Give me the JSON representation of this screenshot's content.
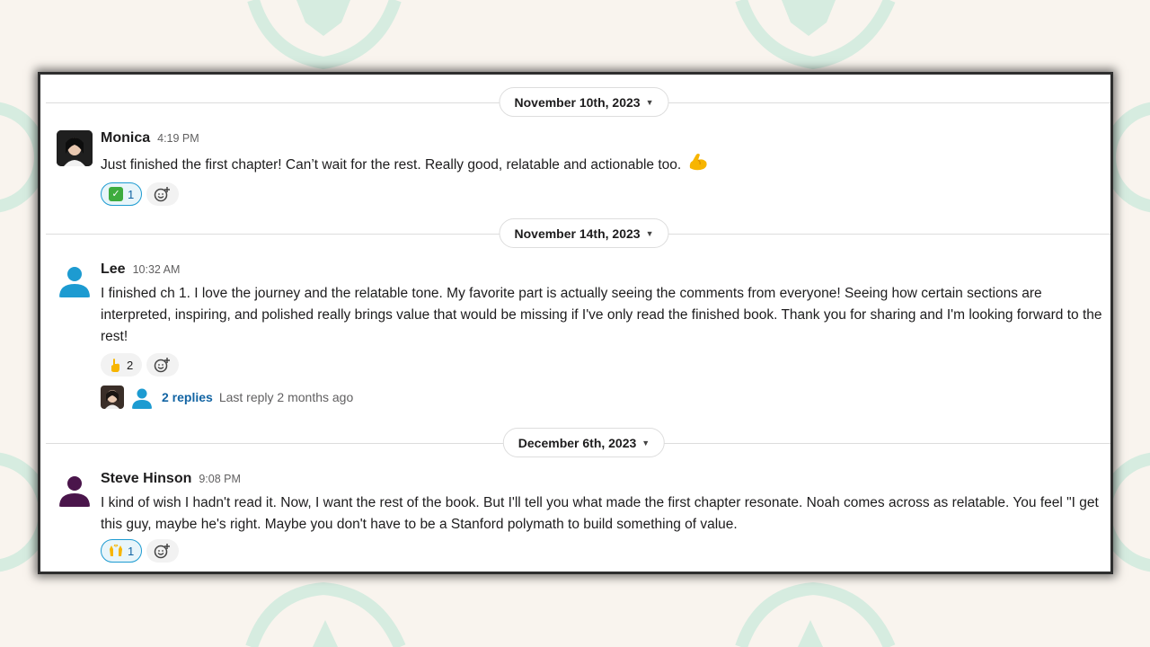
{
  "date_dividers": [
    "November 10th, 2023",
    "November 14th, 2023",
    "December 6th, 2023"
  ],
  "messages": [
    {
      "author": "Monica",
      "time": "4:19 PM",
      "text": "Just finished the first chapter! Can’t wait for the rest. Really good, relatable and actionable too.",
      "trailing_emoji": "flexed-biceps",
      "reaction": {
        "emoji": "white-check-mark",
        "count": "1",
        "active": true
      }
    },
    {
      "author": "Lee",
      "time": "10:32 AM",
      "text": "I finished ch 1. I love the journey and the relatable tone.  My favorite part is actually seeing the comments from everyone! Seeing how certain sections are interpreted, inspiring, and polished really brings value that would be missing if I've only read the finished book.  Thank you for sharing and I'm looking forward to the rest!",
      "reaction": {
        "emoji": "pointing-hand",
        "count": "2",
        "active": false
      },
      "thread": {
        "replies": "2 replies",
        "last_reply": "Last reply 2 months ago"
      }
    },
    {
      "author": "Steve Hinson",
      "time": "9:08 PM",
      "text": "I kind of wish I hadn't read it.  Now, I want the rest of the book.  But I'll tell you what made the first chapter resonate.  Noah comes across as relatable.  You feel \"I get this guy, maybe he's right.  Maybe you don't have to be a Stanford polymath to build something of value.",
      "reaction": {
        "emoji": "raising-hands",
        "count": "1",
        "active": true
      }
    }
  ],
  "colors": {
    "background": "#f9f4ee",
    "decoration": "#d6ece0",
    "link": "#1264a3",
    "reaction_active_border": "#1d9bd1",
    "avatar_lee": "#1d9bd1",
    "avatar_steve": "#4a154b"
  }
}
